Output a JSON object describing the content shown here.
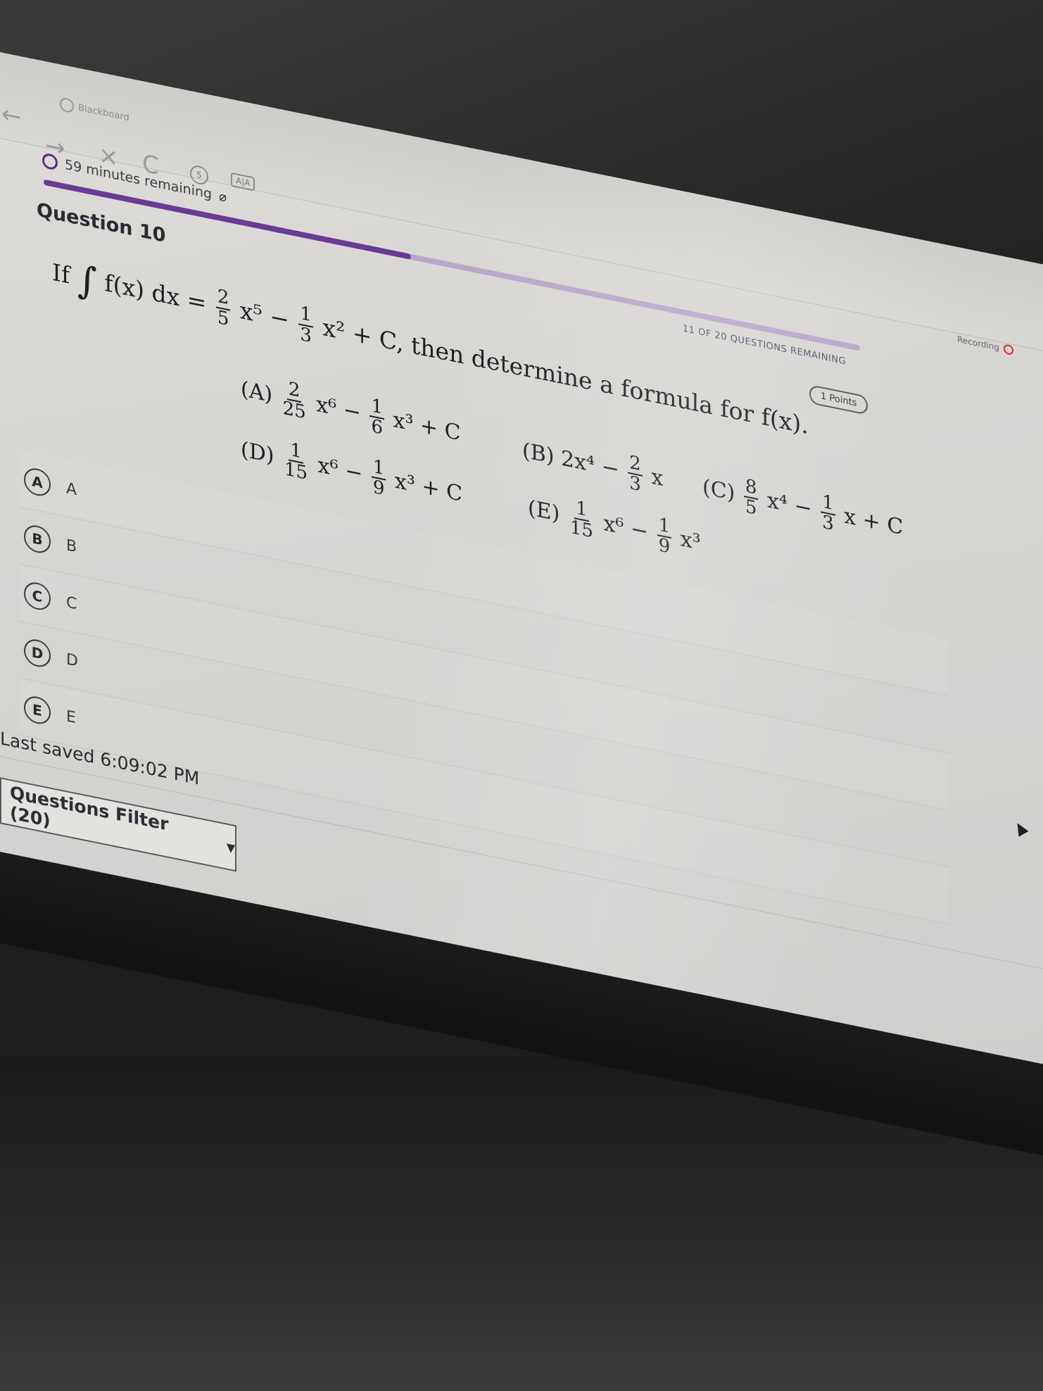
{
  "browser": {
    "tab_title": "Blackboard",
    "icons": {
      "back": "arrow-left-icon",
      "forward": "arrow-right-icon",
      "close": "close-icon",
      "reload": "reload-icon",
      "clock": "clock-icon",
      "reader": "reader-mode-icon"
    },
    "close_glyph": "×",
    "reload_glyph": "C",
    "reader_glyph": "A|A"
  },
  "status": {
    "timer_text": "59 minutes remaining",
    "questions_remaining": "11 OF 20 QUESTIONS REMAINING",
    "recording": "Recording",
    "progress_fraction": 0.45,
    "accent": "#6a3b95"
  },
  "question": {
    "title": "Question 10",
    "points": "1 Points",
    "stem": {
      "if": "If",
      "fx": "f(x) dx =",
      "frac1_num": "2",
      "frac1_den": "5",
      "term1": "x⁵ −",
      "frac2_num": "1",
      "frac2_den": "3",
      "term2": "x² + C, then determine a formula for f(x)."
    },
    "choices_math": {
      "A": {
        "label": "(A)",
        "f1n": "2",
        "f1d": "25",
        "t1": "x⁶ −",
        "f2n": "1",
        "f2d": "6",
        "t2": "x³ + C"
      },
      "B": {
        "label": "(B)",
        "t0": "2x⁴ −",
        "f1n": "2",
        "f1d": "3",
        "t1": "x"
      },
      "C": {
        "label": "(C)",
        "f1n": "8",
        "f1d": "5",
        "t1": "x⁴ −",
        "f2n": "1",
        "f2d": "3",
        "t2": "x + C"
      },
      "D": {
        "label": "(D)",
        "f1n": "1",
        "f1d": "15",
        "t1": "x⁶ −",
        "f2n": "1",
        "f2d": "9",
        "t2": "x³ + C"
      },
      "E": {
        "label": "(E)",
        "f1n": "1",
        "f1d": "15",
        "t1": "x⁶ −",
        "f2n": "1",
        "f2d": "9",
        "t2": "x³"
      }
    }
  },
  "answers": [
    {
      "letter": "A",
      "label": "A"
    },
    {
      "letter": "B",
      "label": "B"
    },
    {
      "letter": "C",
      "label": "C"
    },
    {
      "letter": "D",
      "label": "D"
    },
    {
      "letter": "E",
      "label": "E"
    }
  ],
  "footer": {
    "last_saved": "Last saved 6:09:02 PM",
    "filter_label": "Questions Filter (20)",
    "filter_caret": "▼"
  }
}
